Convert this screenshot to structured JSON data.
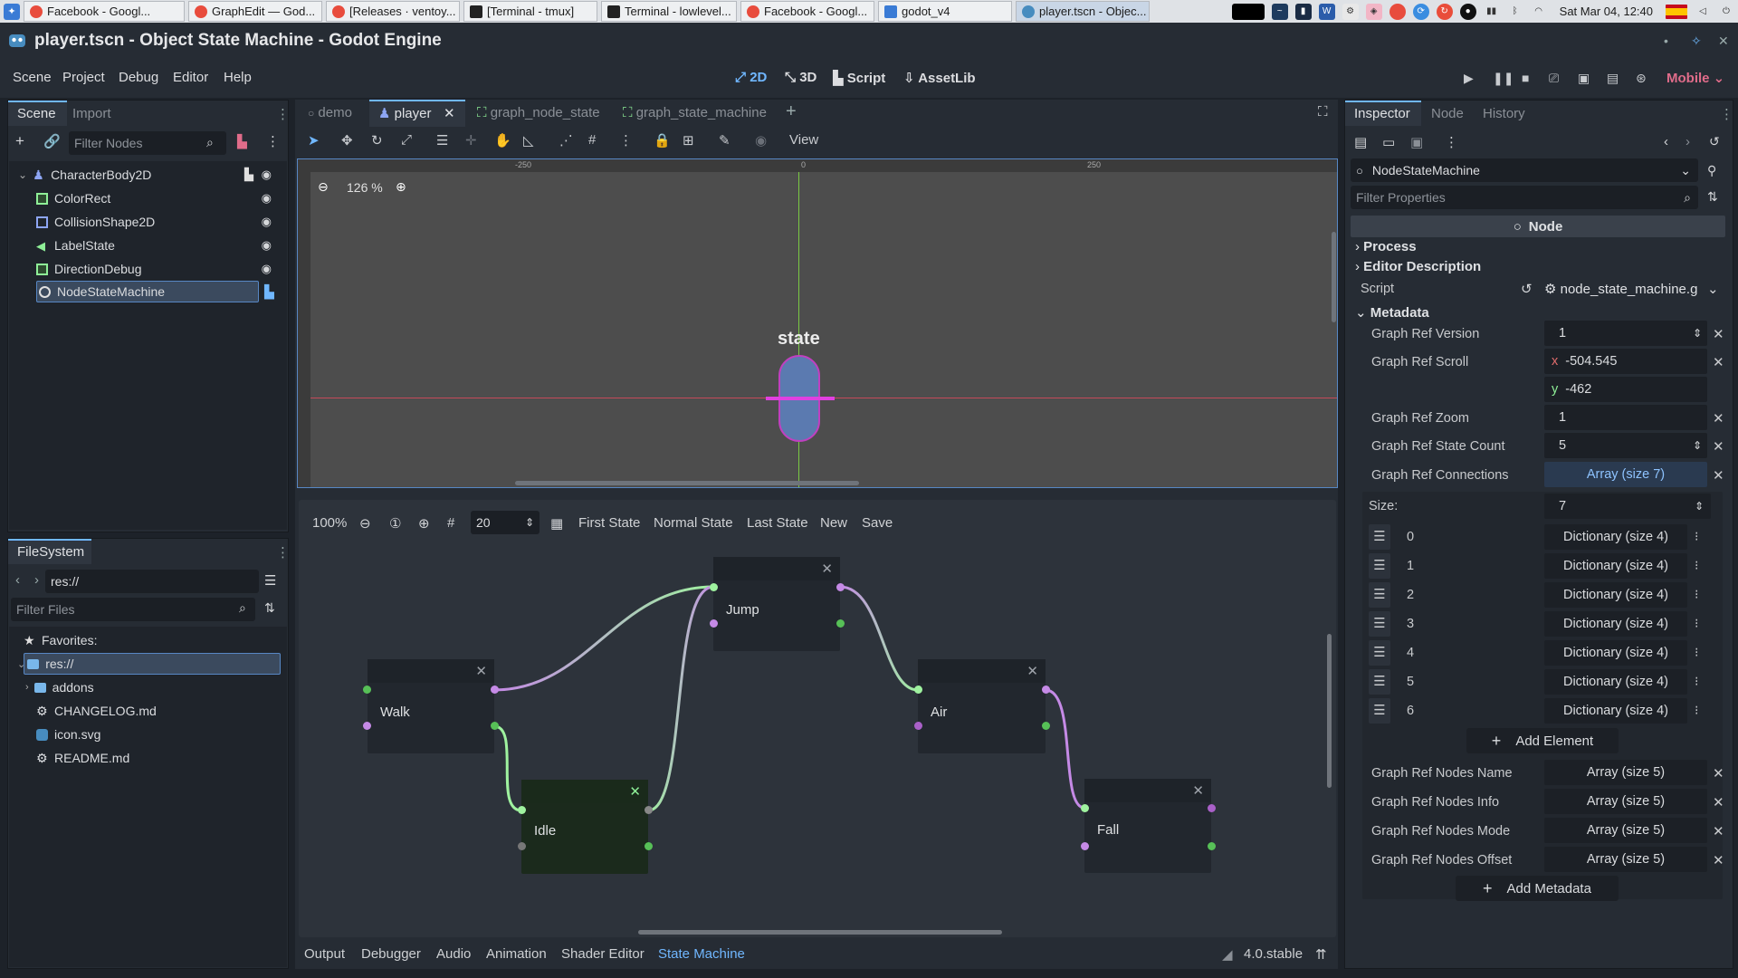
{
  "taskbar": {
    "tasks": [
      {
        "label": "Facebook - Googl...",
        "color": "#e84c3d"
      },
      {
        "label": "GraphEdit — God...",
        "color": "#e84c3d"
      },
      {
        "label": "[Releases · ventoy...",
        "color": "#e84c3d"
      },
      {
        "label": "[Terminal - tmux]",
        "color": "#222222"
      },
      {
        "label": "Terminal - lowlevel...",
        "color": "#222222"
      },
      {
        "label": "Facebook - Googl...",
        "color": "#e84c3d"
      },
      {
        "label": "godot_v4",
        "color": "#3a7bd5"
      },
      {
        "label": "player.tscn - Objec...",
        "color": "#478cbf"
      }
    ],
    "clock": "Sat Mar 04, 12:40"
  },
  "window": {
    "title": "player.tscn - Object State Machine - Godot Engine"
  },
  "menu": {
    "items": [
      "Scene",
      "Project",
      "Debug",
      "Editor",
      "Help"
    ],
    "workspaces": [
      "2D",
      "3D",
      "Script",
      "AssetLib"
    ],
    "renderer": "Mobile"
  },
  "scene_dock": {
    "tabs": [
      "Scene",
      "Import"
    ],
    "filter_placeholder": "Filter Nodes",
    "nodes": [
      {
        "label": "CharacterBody2D",
        "icon": "character-body-icon",
        "color": "#8da5f3"
      },
      {
        "label": "ColorRect",
        "icon": "color-rect-icon",
        "color": "#8eef97"
      },
      {
        "label": "CollisionShape2D",
        "icon": "collision-shape-icon",
        "color": "#8da5f3"
      },
      {
        "label": "LabelState",
        "icon": "label-icon",
        "color": "#8eef97"
      },
      {
        "label": "DirectionDebug",
        "icon": "color-rect-icon",
        "color": "#8eef97"
      },
      {
        "label": "NodeStateMachine",
        "icon": "node-icon",
        "color": "#e0e0e0"
      }
    ]
  },
  "filesystem_dock": {
    "tab": "FileSystem",
    "path": "res://",
    "filter_placeholder": "Filter Files",
    "items": [
      {
        "label": "Favorites:",
        "icon": "star-icon"
      },
      {
        "label": "res://",
        "icon": "folder-icon"
      },
      {
        "label": "addons",
        "icon": "folder-icon"
      },
      {
        "label": "CHANGELOG.md",
        "icon": "gear-file-icon"
      },
      {
        "label": "icon.svg",
        "icon": "image-file-icon"
      },
      {
        "label": "README.md",
        "icon": "gear-file-icon"
      }
    ]
  },
  "editor_tabs": [
    "demo",
    "player",
    "graph_node_state",
    "graph_state_machine"
  ],
  "viewport": {
    "zoom": "126 %",
    "view_menu": "View",
    "ruler_labels": [
      "-250",
      "0",
      "250"
    ],
    "state_label": "state"
  },
  "graph_editor": {
    "zoom": "100%",
    "snap": "20",
    "toolbar": [
      "First State",
      "Normal State",
      "Last State",
      "New",
      "Save"
    ],
    "nodes": [
      {
        "name": "Jump",
        "active": false
      },
      {
        "name": "Walk",
        "active": false
      },
      {
        "name": "Air",
        "active": false
      },
      {
        "name": "Idle",
        "active": true
      },
      {
        "name": "Fall",
        "active": false
      }
    ]
  },
  "bottom_panel": {
    "tabs": [
      "Output",
      "Debugger",
      "Audio",
      "Animation",
      "Shader Editor",
      "State Machine"
    ],
    "version": "4.0.stable"
  },
  "inspector": {
    "tabs": [
      "Inspector",
      "Node",
      "History"
    ],
    "object": "NodeStateMachine",
    "filter_placeholder": "Filter Properties",
    "class_header": "Node",
    "sections": [
      "Process",
      "Editor Description"
    ],
    "script_label": "Script",
    "script_value": "node_state_machine.g",
    "metadata_label": "Metadata",
    "props": [
      {
        "label": "Graph Ref Version",
        "value": "1"
      },
      {
        "label": "Graph Ref Scroll",
        "x": "-504.545",
        "y": "-462"
      },
      {
        "label": "Graph Ref Zoom",
        "value": "1"
      },
      {
        "label": "Graph Ref State Count",
        "value": "5"
      },
      {
        "label": "Graph Ref Connections",
        "value": "Array (size 7)"
      }
    ],
    "size_label": "Size:",
    "size_value": "7",
    "elements": [
      {
        "index": "0",
        "value": "Dictionary (size 4)"
      },
      {
        "index": "1",
        "value": "Dictionary (size 4)"
      },
      {
        "index": "2",
        "value": "Dictionary (size 4)"
      },
      {
        "index": "3",
        "value": "Dictionary (size 4)"
      },
      {
        "index": "4",
        "value": "Dictionary (size 4)"
      },
      {
        "index": "5",
        "value": "Dictionary (size 4)"
      },
      {
        "index": "6",
        "value": "Dictionary (size 4)"
      }
    ],
    "add_element": "Add Element",
    "array_props": [
      {
        "label": "Graph Ref Nodes Name",
        "value": "Array (size 5)"
      },
      {
        "label": "Graph Ref Nodes Info",
        "value": "Array (size 5)"
      },
      {
        "label": "Graph Ref Nodes Mode",
        "value": "Array (size 5)"
      },
      {
        "label": "Graph Ref Nodes Offset",
        "value": "Array (size 5)"
      }
    ],
    "add_metadata": "Add Metadata"
  },
  "colors": {
    "accent": "#70b7ff",
    "connection_green": "#9ff29f",
    "connection_purple": "#c58ae6"
  }
}
